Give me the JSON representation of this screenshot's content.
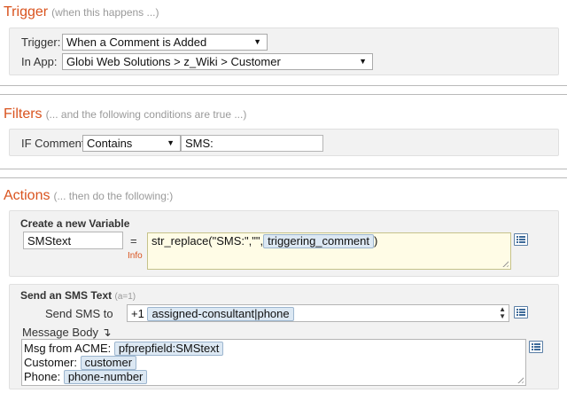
{
  "trigger": {
    "title": "Trigger",
    "subtitle": "(when this happens ...)",
    "trigger_label": "Trigger:",
    "trigger_value": "When a Comment is Added",
    "app_label": "In App:",
    "app_value": "Globi Web Solutions > z_Wiki > Customer"
  },
  "filters": {
    "title": "Filters",
    "subtitle": "(... and the following conditions are true ...)",
    "if_label": "IF Comment",
    "condition_value": "Contains",
    "filter_value": "SMS:"
  },
  "actions": {
    "title": "Actions",
    "subtitle": "(... then do the following:)",
    "variable": {
      "heading": "Create a new Variable",
      "name_value": "SMStext",
      "equals": "=",
      "info_label": "Info",
      "expression_prefix": "str_replace(\"SMS:\",\"\",",
      "expression_token": "triggering_comment",
      "expression_suffix": ")"
    },
    "sms": {
      "heading": "Send an SMS Text",
      "heading_note": "(a=1)",
      "send_to_label": "Send SMS to",
      "send_to_prefix": "+1",
      "send_to_token": "assigned-consultant|phone",
      "body_label": "Message Body",
      "body_label_glyph": "↴",
      "body_lines": [
        {
          "text": "Msg from ACME:",
          "token": "pfprepfield:SMStext"
        },
        {
          "text": "Customer:",
          "token": "customer"
        },
        {
          "text": "Phone:",
          "token": "phone-number"
        }
      ]
    }
  },
  "colors": {
    "section_title": "#d9531e",
    "token_bg": "#dce8f3",
    "info": "#d9531e"
  },
  "icons": [
    "field-picker-icon",
    "chevron-down-icon",
    "resize-grip-icon",
    "spinner-icon"
  ]
}
